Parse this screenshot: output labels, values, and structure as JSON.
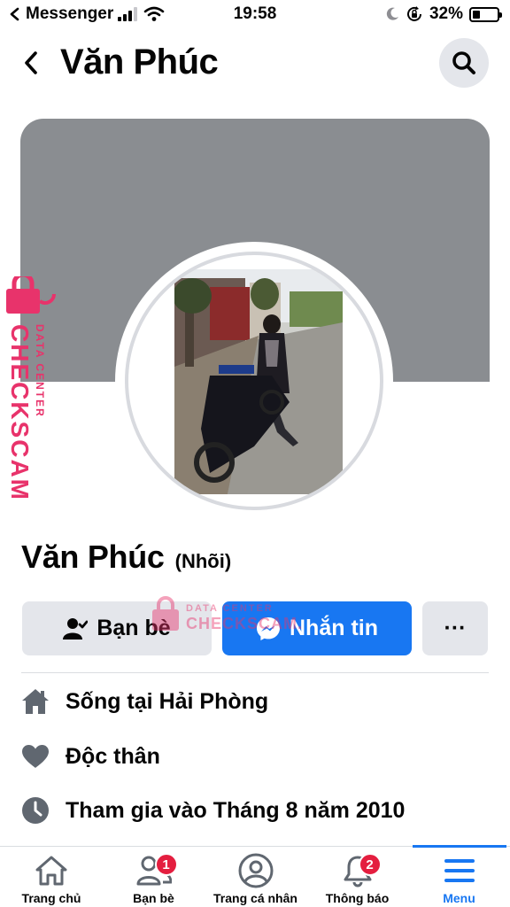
{
  "status_bar": {
    "app": "Messenger",
    "time": "19:58",
    "battery": "32%",
    "battery_level": 0.32
  },
  "header": {
    "title": "Văn Phúc",
    "back_icon": "chevron-left-icon",
    "search_icon": "search-icon"
  },
  "profile": {
    "name": "Văn Phúc",
    "nickname": "(Nhõi)"
  },
  "watermark": {
    "line1": "DATA CENTER",
    "line2": "CHECKSCAM.VN"
  },
  "actions": {
    "friends_label": "Bạn bè",
    "message_label": "Nhắn tin",
    "more_label": "···"
  },
  "intro": {
    "lives_in_prefix": "Sống tại ",
    "lives_in_place": "Hải Phòng",
    "relationship": "Độc thân",
    "joined": "Tham gia vào Tháng 8 năm 2010"
  },
  "tabs": [
    {
      "label": "Trang chủ",
      "icon": "home-icon",
      "badge": ""
    },
    {
      "label": "Bạn bè",
      "icon": "friends-icon",
      "badge": "1"
    },
    {
      "label": "Trang cá nhân",
      "icon": "profile-icon",
      "badge": ""
    },
    {
      "label": "Thông báo",
      "icon": "bell-icon",
      "badge": "2"
    },
    {
      "label": "Menu",
      "icon": "menu-icon",
      "badge": ""
    }
  ],
  "colors": {
    "accent": "#1877f2",
    "cover": "#8a8d91",
    "badge": "#e41e3f",
    "watermark": "#e8336b"
  }
}
